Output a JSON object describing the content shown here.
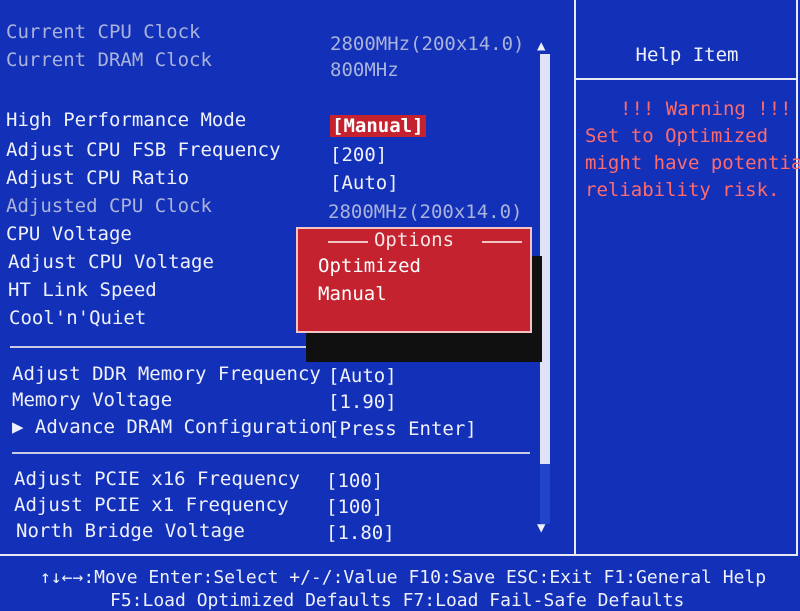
{
  "info": [
    {
      "label": "Current CPU Clock",
      "value": "2800MHz(200x14.0)"
    },
    {
      "label": "Current DRAM Clock",
      "value": "800MHz"
    }
  ],
  "settings1": [
    {
      "label": "High Performance Mode",
      "value": "[Manual]"
    },
    {
      "label": "Adjust CPU FSB Frequency",
      "value": "[200]"
    },
    {
      "label": "Adjust CPU Ratio",
      "value": "[Auto]"
    },
    {
      "label": "Adjusted CPU Clock",
      "value": "2800MHz(200x14.0)"
    },
    {
      "label": "CPU Voltage",
      "value": ""
    },
    {
      "label": "Adjust CPU Voltage",
      "value": ""
    },
    {
      "label": "HT Link Speed",
      "value": ""
    },
    {
      "label": "Cool'n'Quiet",
      "value": ""
    }
  ],
  "settings2": [
    {
      "label": "Adjust DDR Memory Frequency",
      "value": "[Auto]"
    },
    {
      "label": "Memory Voltage",
      "value": "[1.90]"
    },
    {
      "label": "▶ Advance DRAM Configuration",
      "value": "[Press Enter]"
    }
  ],
  "settings3": [
    {
      "label": "Adjust PCIE x16 Frequency",
      "value": "[100]"
    },
    {
      "label": "Adjust PCIE x1 Frequency",
      "value": "[100]"
    },
    {
      "label": "North Bridge Voltage",
      "value": "[1.80]"
    }
  ],
  "help": {
    "title": "Help Item",
    "lines": [
      "!!! Warning !!!",
      "Set to Optimized",
      "might have potential",
      "reliability risk."
    ]
  },
  "popup": {
    "title": "Options",
    "options": [
      "Optimized",
      "Manual"
    ]
  },
  "footer": {
    "line1": "↑↓←→:Move  Enter:Select  +/-/:Value  F10:Save  ESC:Exit  F1:General Help",
    "line2": "F5:Load Optimized Defaults    F7:Load Fail-Safe Defaults"
  },
  "colors": {
    "background": "#1330b8",
    "highlight": "#c3222e",
    "warning": "#ff6b6b"
  }
}
